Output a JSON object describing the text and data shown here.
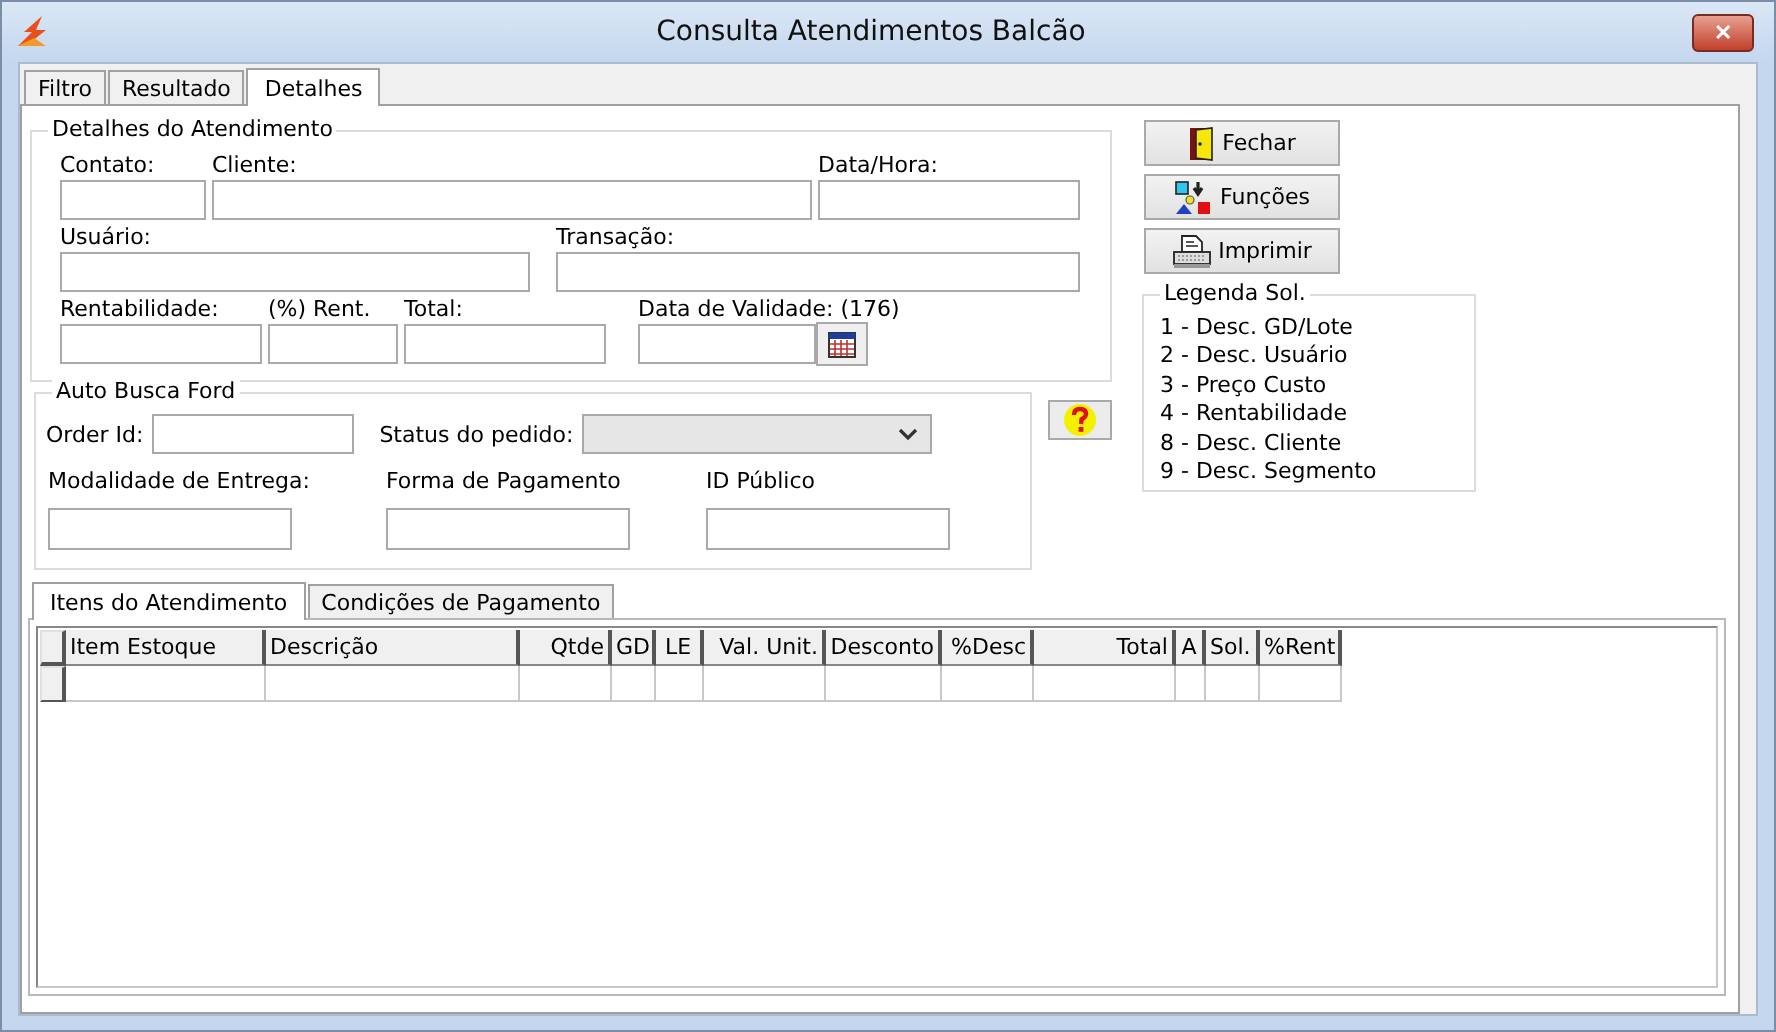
{
  "window": {
    "title": "Consulta Atendimentos Balcão",
    "close_label": "✕"
  },
  "tabs": [
    {
      "label": "Filtro",
      "selected": false
    },
    {
      "label": "Resultado",
      "selected": false
    },
    {
      "label": "Detalhes",
      "selected": true
    }
  ],
  "details": {
    "title": "Detalhes do Atendimento",
    "lines": [
      {
        "fields": [
          {
            "label": "Contato:"
          },
          {
            "label": "Cliente:"
          },
          {
            "label": "Data/Hora:"
          }
        ]
      },
      {
        "fields": [
          {
            "label": "Usuário:"
          },
          {
            "label": "Transação:"
          }
        ]
      },
      {
        "fields": [
          {
            "label": "Rentabilidade:"
          },
          {
            "label": "(%) Rent."
          },
          {
            "label": "Total:"
          },
          {
            "label": "Data de Validade: (176)",
            "kind": "date"
          }
        ]
      }
    ]
  },
  "auto_busca": {
    "title": "Auto Busca Ford",
    "order_id": {
      "label": "Order Id:"
    },
    "status": {
      "label": "Status do pedido:"
    },
    "fields": [
      {
        "label": "Modalidade de Entrega:"
      },
      {
        "label": "Forma de Pagamento"
      },
      {
        "label": "ID Público"
      }
    ]
  },
  "buttons": [
    {
      "label": "Fechar",
      "kind": "door"
    },
    {
      "label": "Funções",
      "kind": "functions"
    },
    {
      "label": "Imprimir",
      "kind": "printer"
    }
  ],
  "legend": {
    "title": "Legenda Sol.",
    "items": [
      "1 - Desc. GD/Lote",
      "2 - Desc. Usuário",
      "3 - Preço Custo",
      "4 - Rentabilidade",
      "8 - Desc. Cliente",
      "9 - Desc. Segmento"
    ]
  },
  "bottom_tabs": [
    {
      "label": "Itens do Atendimento",
      "selected": true
    },
    {
      "label": "Condições de Pagamento",
      "selected": false
    }
  ],
  "table": {
    "columns": [
      "Item Estoque",
      "Descrição",
      "Qtde",
      "GD",
      "LE",
      "Val. Unit.",
      "Desconto",
      "%Desc",
      "Total",
      "A",
      "Sol.",
      "%Rent"
    ]
  }
}
